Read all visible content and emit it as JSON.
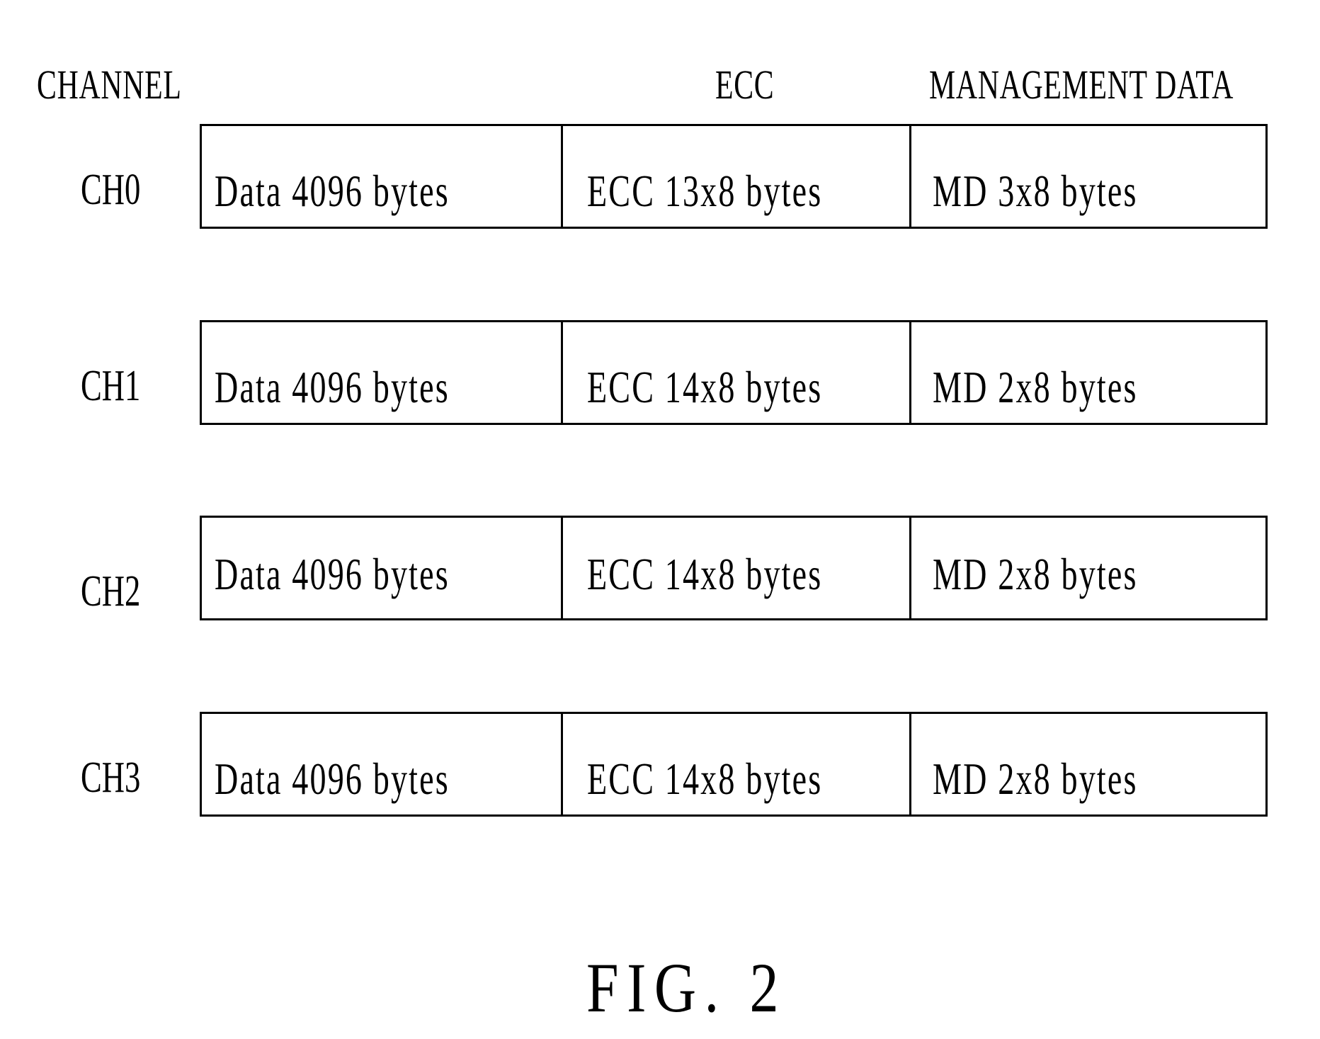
{
  "headers": {
    "channel": "CHANNEL",
    "ecc": "ECC",
    "management_data": "MANAGEMENT DATA"
  },
  "rows": [
    {
      "channel": "CH0",
      "data": "Data 4096 bytes",
      "ecc": "ECC 13x8 bytes",
      "md": "MD 3x8 bytes"
    },
    {
      "channel": "CH1",
      "data": "Data 4096 bytes",
      "ecc": "ECC 14x8 bytes",
      "md": "MD 2x8 bytes"
    },
    {
      "channel": "CH2",
      "data": "Data 4096 bytes",
      "ecc": "ECC 14x8 bytes",
      "md": "MD 2x8 bytes"
    },
    {
      "channel": "CH3",
      "data": "Data 4096 bytes",
      "ecc": "ECC 14x8 bytes",
      "md": "MD 2x8 bytes"
    }
  ],
  "caption": "FIG. 2"
}
